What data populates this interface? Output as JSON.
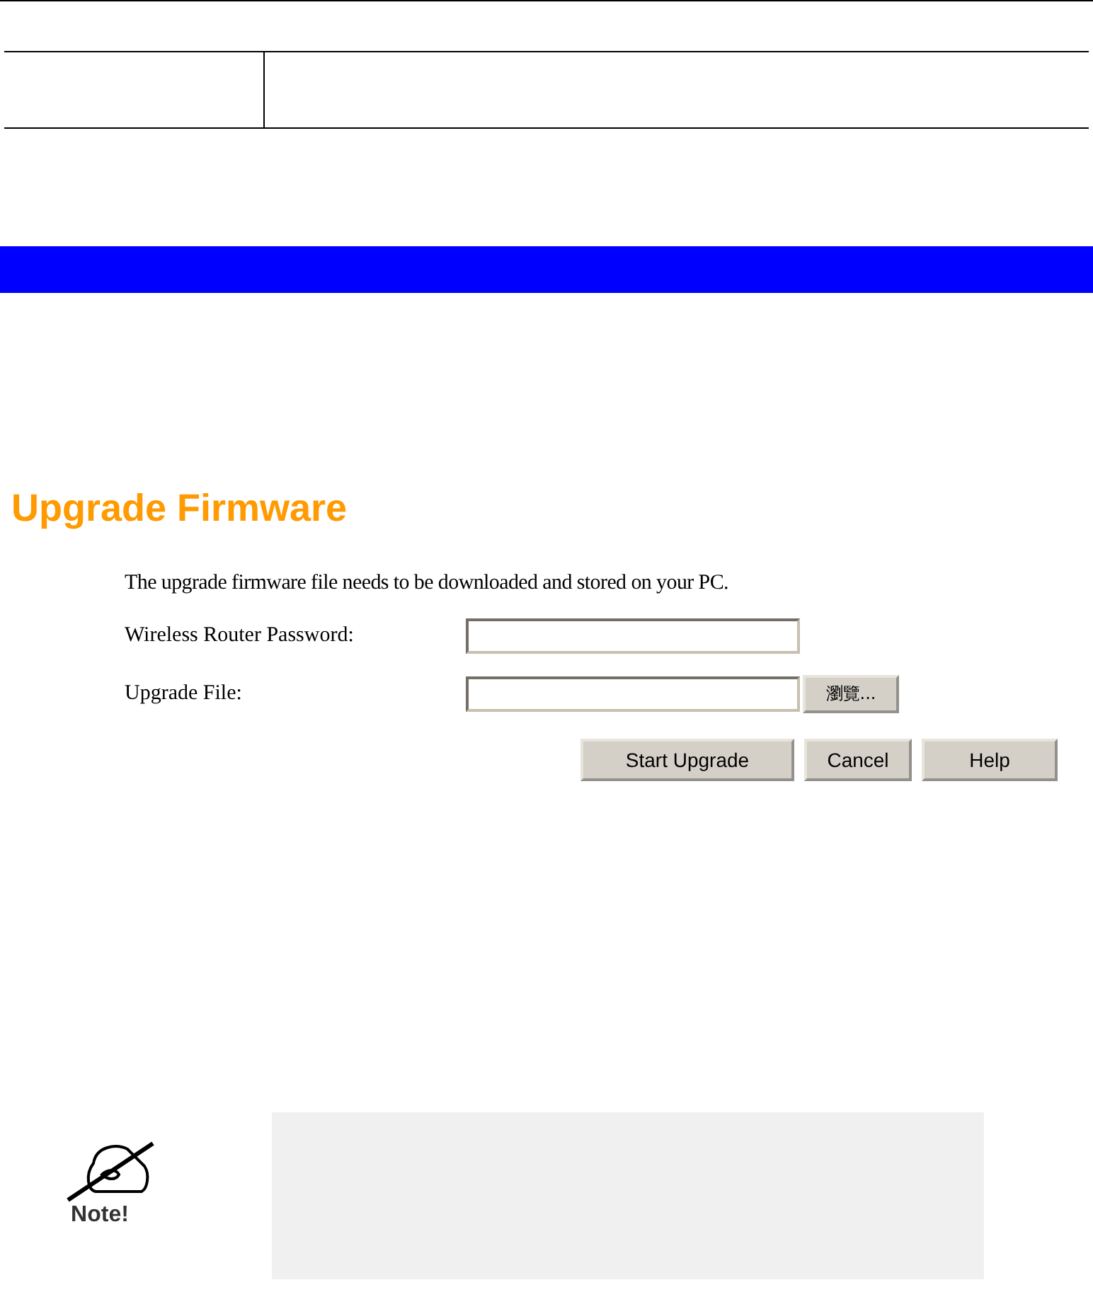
{
  "title": "Upgrade Firmware",
  "intro": "The upgrade firmware file needs to be downloaded and stored on your PC.",
  "fields": [
    {
      "label": "Wireless Router Password:",
      "kind": "password"
    },
    {
      "label": "Upgrade File:",
      "kind": "file",
      "browse": "瀏覽..."
    }
  ],
  "buttons": [
    "Start Upgrade",
    "Cancel",
    "Help"
  ],
  "note": {
    "label": "Note!"
  }
}
